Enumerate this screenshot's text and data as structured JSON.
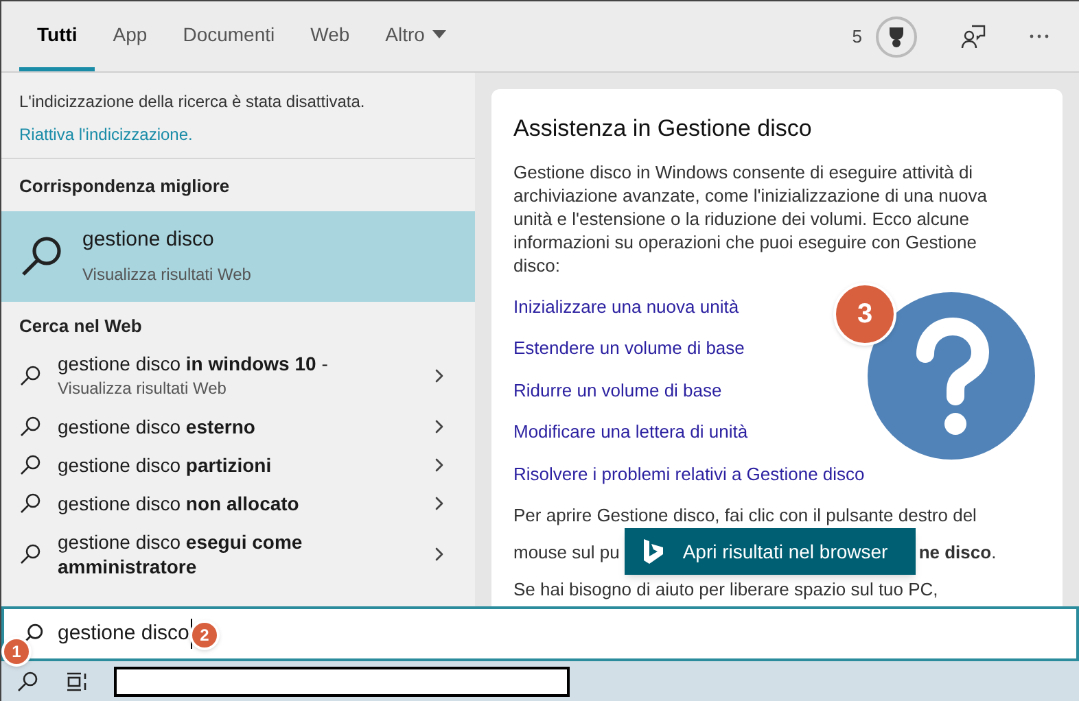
{
  "tabs": [
    {
      "label": "Tutti",
      "selected": true,
      "kind": "plain"
    },
    {
      "label": "App",
      "selected": false,
      "kind": "plain"
    },
    {
      "label": "Documenti",
      "selected": false,
      "kind": "plain"
    },
    {
      "label": "Web",
      "selected": false,
      "kind": "plain"
    },
    {
      "label": "Altro",
      "selected": false,
      "kind": "dropdown"
    }
  ],
  "header": {
    "points": "5"
  },
  "notice": {
    "text": "L'indicizzazione della ricerca è stata disattivata.",
    "link": "Riattiva l'indicizzazione."
  },
  "best_match": {
    "heading": "Corrispondenza migliore",
    "title": "gestione disco",
    "subtitle": "Visualizza risultati Web",
    "selected": true
  },
  "web": {
    "heading": "Cerca nel Web",
    "items": [
      {
        "text": "gestione disco **in windows 10** -",
        "subtitle": "Visualizza risultati Web"
      },
      {
        "text": "gestione disco **esterno**"
      },
      {
        "text": "gestione disco **partizioni**"
      },
      {
        "text": "gestione disco **non allocato**"
      },
      {
        "text": "gestione disco **esegui come amministratore**"
      }
    ]
  },
  "card": {
    "title": "Assistenza in Gestione disco",
    "intro": "Gestione disco in Windows consente di eseguire attività di archiviazione avanzate, come l'inizializzazione di una nuova unità e l'estensione o la riduzione dei volumi. Ecco alcune informazioni su operazioni che puoi eseguire con Gestione disco:",
    "links": [
      "Inizializzare una nuova unità",
      "Estendere un volume di base",
      "Ridurre un volume di base",
      "Modificare una lettera di unità",
      "Risolvere i problemi relativi a Gestione disco"
    ],
    "paragraph_start": "Per aprire Gestione disco, fai clic con il pulsante destro del",
    "paragraph_left": "mouse sul pu",
    "paragraph_right": "**ne disco**.",
    "note": "Se hai bisogno di aiuto per liberare spazio sul tuo PC,",
    "open_button": "Apri risultati nel browser"
  },
  "search": {
    "value": "gestione disco"
  },
  "badges": [
    "1",
    "2",
    "3"
  ]
}
